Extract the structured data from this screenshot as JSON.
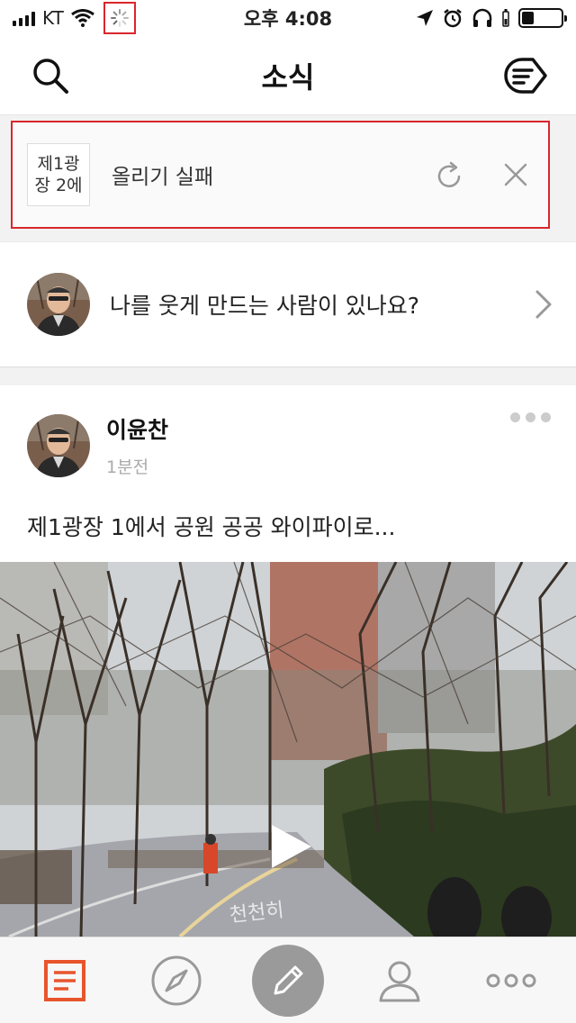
{
  "status_bar": {
    "carrier": "KT",
    "time": "오후 4:08"
  },
  "nav": {
    "title": "소식"
  },
  "upload": {
    "thumb_label": "제1광장 2에",
    "status_text": "올리기 실패"
  },
  "question": {
    "text": "나를 웃게 만드는 사람이 있나요?"
  },
  "post": {
    "author": "이윤찬",
    "time": "1분전",
    "text": "제1광장 1에서 공원 공공 와이파이로..."
  },
  "tab_bar": {
    "items": [
      {
        "icon": "feed-icon",
        "active": true
      },
      {
        "icon": "compass-icon",
        "active": false
      },
      {
        "icon": "pencil-icon",
        "active": false
      },
      {
        "icon": "profile-icon",
        "active": false
      },
      {
        "icon": "more-icon",
        "active": false
      }
    ]
  },
  "colors": {
    "accent": "#e8552c",
    "highlight_border": "#d9262c",
    "icon_gray": "#9a9a9a"
  }
}
